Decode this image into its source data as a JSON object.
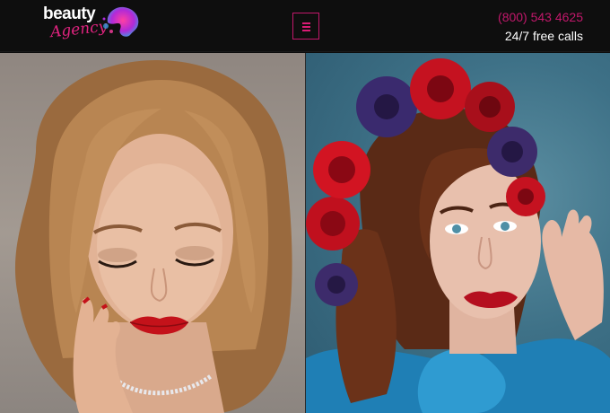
{
  "header": {
    "logo": {
      "word": "beauty",
      "script": "Agency"
    },
    "menu_icon": "hamburger-menu-icon",
    "phone": "(800) 543 4625",
    "calls_note": "24/7 free calls"
  },
  "colors": {
    "accent": "#c2186b",
    "header_bg": "#0e0e0e",
    "text": "#ffffff"
  },
  "gallery": [
    {
      "name": "blonde-model-portrait"
    },
    {
      "name": "flower-crown-model-portrait"
    }
  ]
}
